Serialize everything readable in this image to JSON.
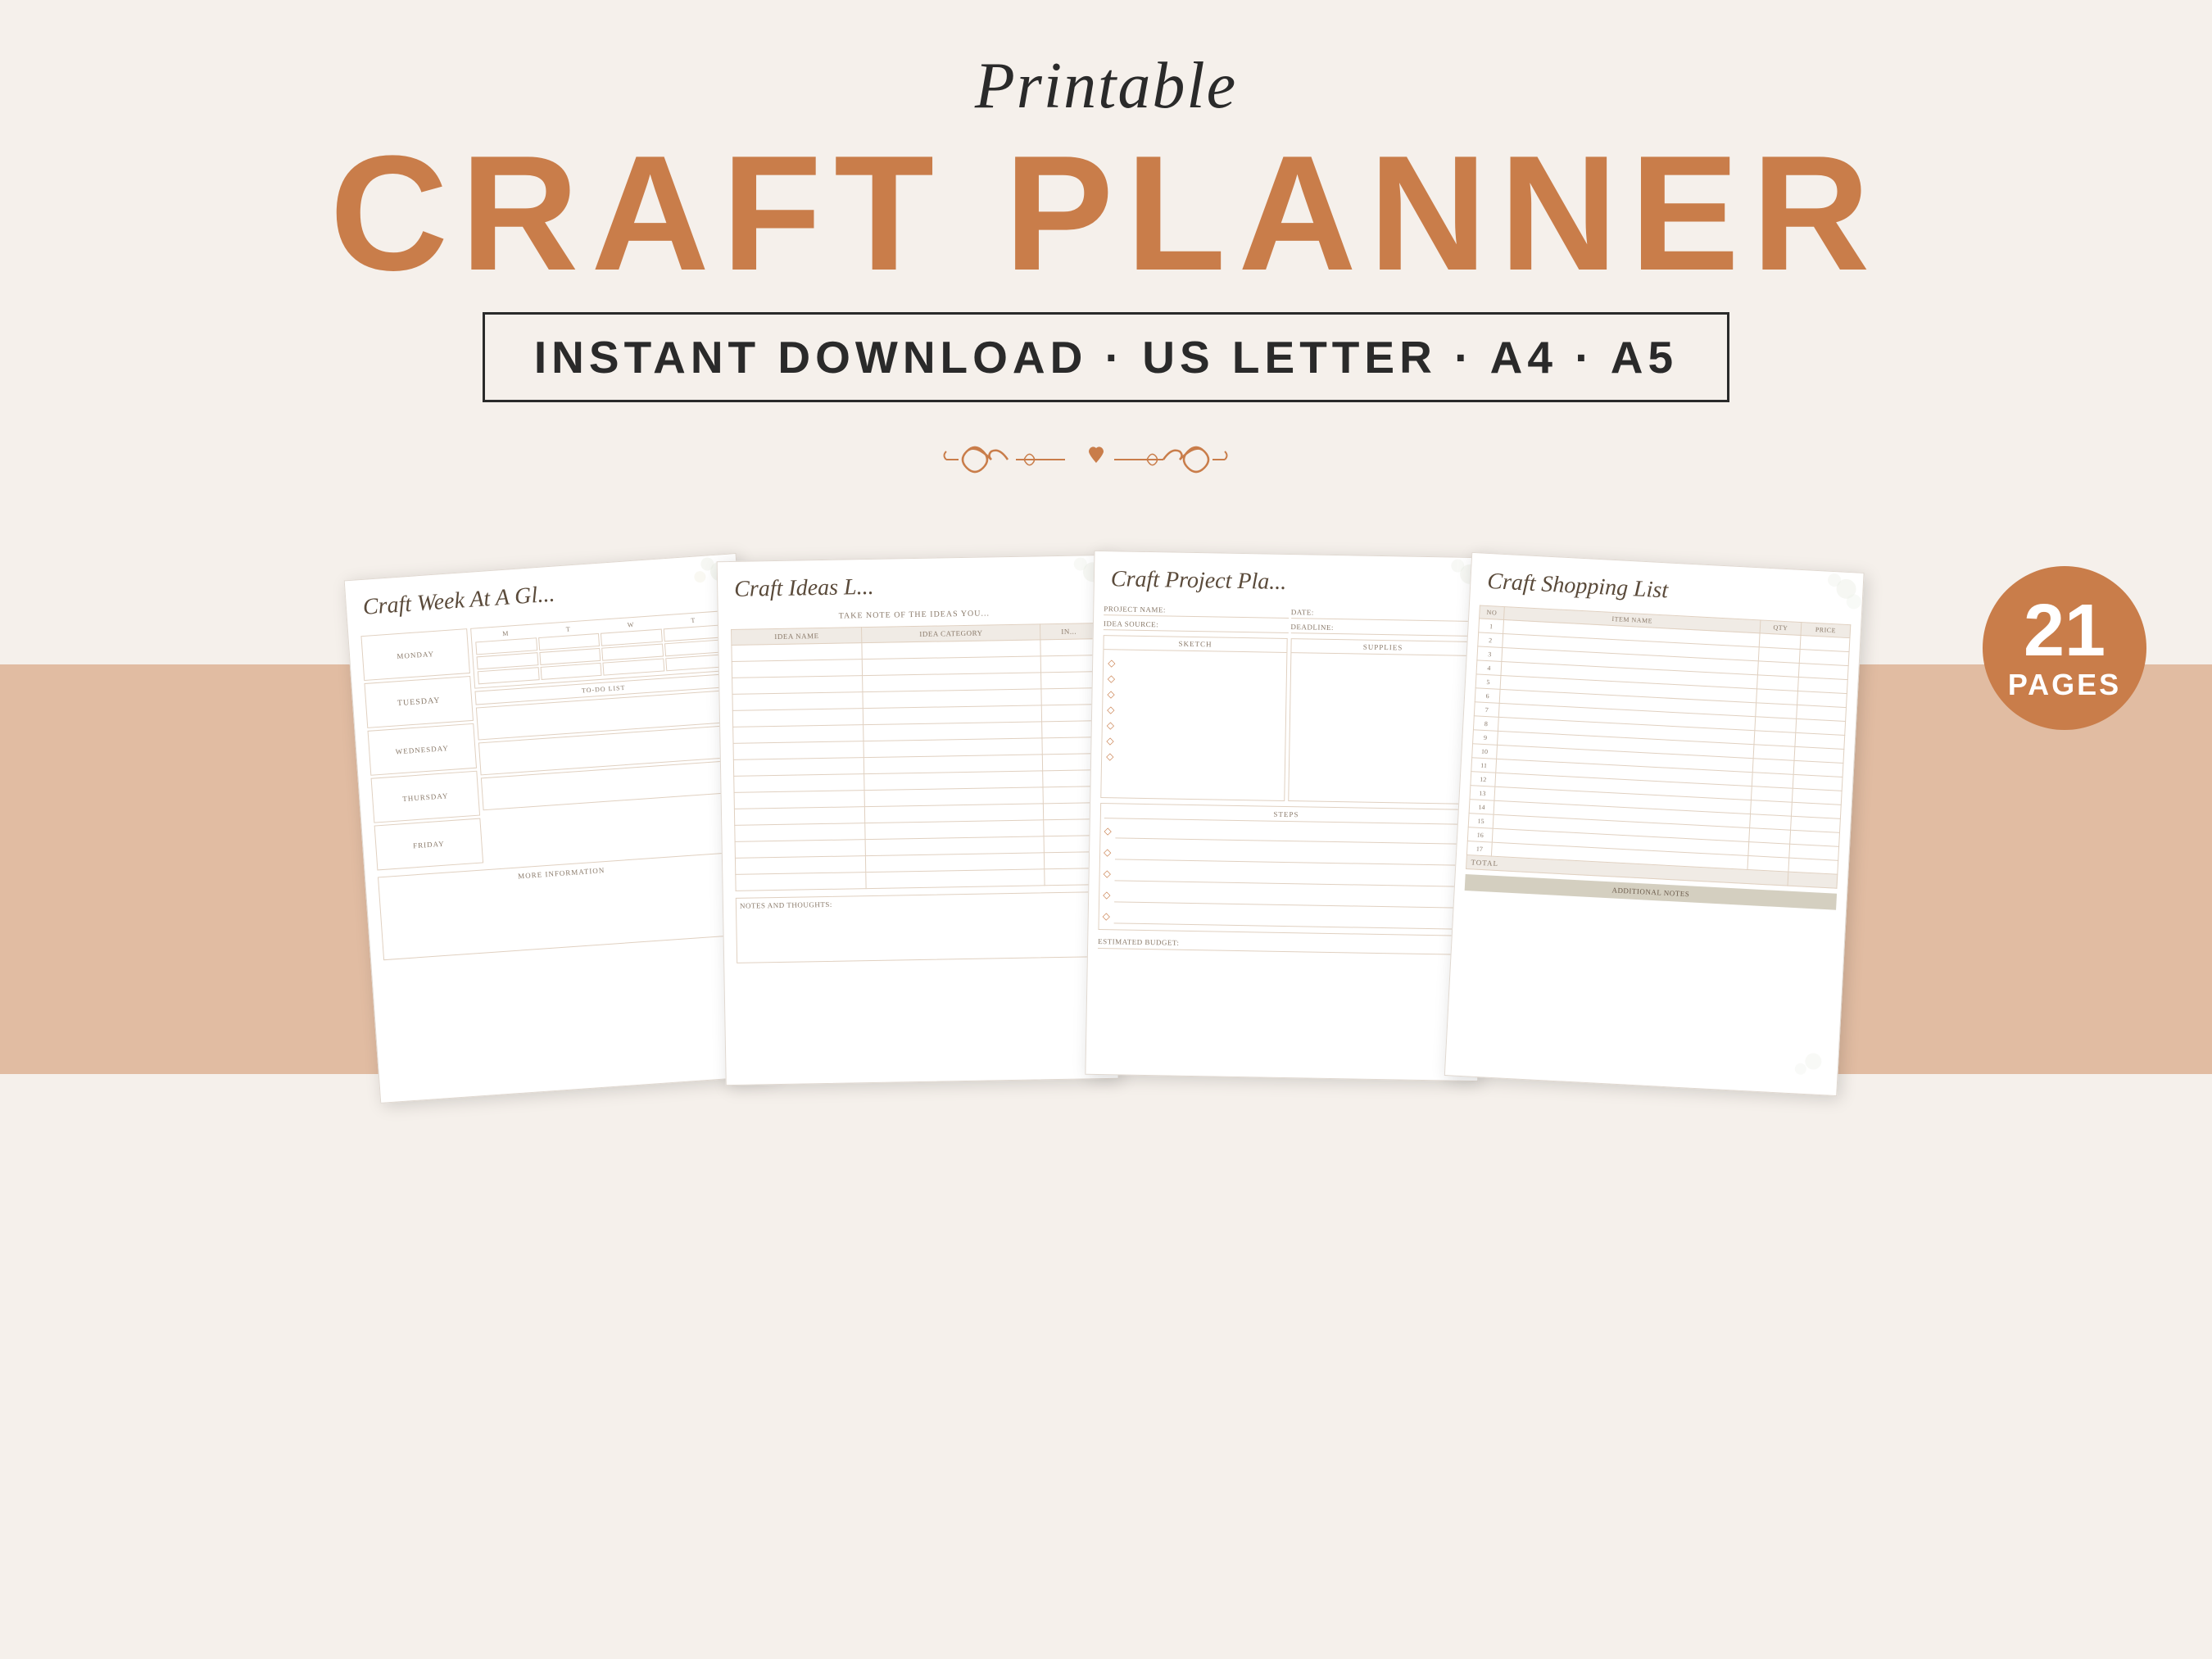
{
  "header": {
    "printable_label": "Printable",
    "main_title": "CRAFT PLANNER",
    "subtitle": "INSTANT DOWNLOAD · US LETTER · A4 · A5"
  },
  "badge": {
    "number": "21",
    "label": "PAGES"
  },
  "pages": [
    {
      "id": "page1",
      "title": "Craft Week At A Gl...",
      "days": [
        "MONDAY",
        "TUESDAY",
        "WEDNESDAY",
        "THURSDAY",
        "FRIDAY"
      ],
      "grid_headers": [
        "M",
        "T",
        "W",
        "T"
      ],
      "todo_label": "TO-DO LIST",
      "more_info_label": "MORE INFORMATION"
    },
    {
      "id": "page2",
      "title": "Craft Ideas L...",
      "subtitle": "TAKE NOTE OF THE IDEAS YOU...",
      "columns": [
        "IDEA NAME",
        "IDEA CATEGORY",
        "IN..."
      ],
      "notes_label": "NOTES AND THOUGHTS:"
    },
    {
      "id": "page3",
      "title": "Craft Project Pla...",
      "fields": [
        "PROJECT NAME:",
        "DATE:",
        "IDEA SOURCE:",
        "DEADLINE:"
      ],
      "sections": [
        "SKETCH",
        "SUPPLIES",
        "STEPS"
      ],
      "budget_label": "ESTIMATED BUDGET:"
    },
    {
      "id": "page4",
      "title": "Craft Shopping List",
      "columns": [
        "NO",
        "ITEM NAME",
        "QTY",
        "PRICE"
      ],
      "rows": [
        "1",
        "2",
        "3",
        "4",
        "5",
        "6",
        "7",
        "8",
        "9",
        "10",
        "11",
        "12",
        "13",
        "14",
        "15",
        "16",
        "17"
      ],
      "total_label": "TOTAL",
      "additional_notes_label": "ADDITIONAL NOTES"
    }
  ]
}
